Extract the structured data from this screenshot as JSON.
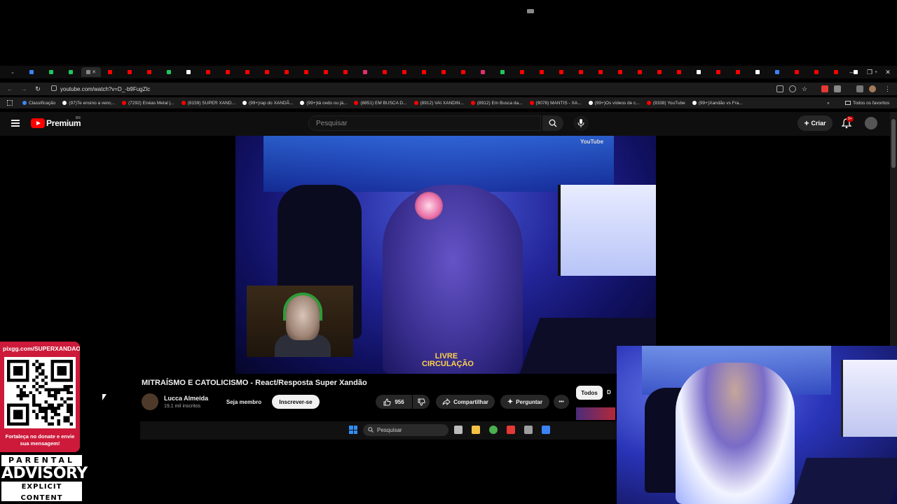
{
  "browser": {
    "tab_colors": [
      "#3b82f6",
      "#22c55e",
      "#22c55e",
      "#888888",
      "#ff0000",
      "#ff0000",
      "#ff0000",
      "#22c55e",
      "#ffffff",
      "#ff0000",
      "#ff0000",
      "#ff0000",
      "#ff0000",
      "#ff0000",
      "#ff0000",
      "#ff0000",
      "#ff0000",
      "#e1306c",
      "#ff0000",
      "#ff0000",
      "#ff0000",
      "#ff0000",
      "#ff0000",
      "#e1306c",
      "#22c55e",
      "#ff0000",
      "#ff0000",
      "#ff0000",
      "#ff0000",
      "#ff0000",
      "#ff0000",
      "#ff0000",
      "#ff0000",
      "#ff0000",
      "#ffffff",
      "#ff0000",
      "#ff0000",
      "#ffffff",
      "#3b82f6",
      "#ff0000",
      "#ff0000",
      "#ff0000",
      "#ffffff"
    ],
    "new_tab": "+",
    "minimize": "–",
    "maximize": "❐",
    "close": "✕",
    "back": "←",
    "forward": "→",
    "reload": "↻",
    "url": "youtube.com/watch?v=D_-b9FugZlc",
    "bookmarks": [
      {
        "label": "Classificação",
        "color": "#4285f4"
      },
      {
        "label": "(97)Te ensino a venc...",
        "color": "#ffffff"
      },
      {
        "label": "(7292) Enéas Metal |...",
        "color": "#ff0000"
      },
      {
        "label": "(8159) SUPER XAND...",
        "color": "#ff0000"
      },
      {
        "label": "(99+)rap do XANDÃ...",
        "color": "#ffffff"
      },
      {
        "label": "(99+)tá cedo ou já...",
        "color": "#ffffff"
      },
      {
        "label": "(8851) EM BUSCA D...",
        "color": "#ff0000"
      },
      {
        "label": "(8912) VAI XANDIN...",
        "color": "#ff0000"
      },
      {
        "label": "(8912) Em Busca da...",
        "color": "#ff0000"
      },
      {
        "label": "(9078) MANTIS - XA...",
        "color": "#ff0000"
      },
      {
        "label": "(99+)Os vídeos de c...",
        "color": "#ffffff"
      },
      {
        "label": "(9338) YouTube",
        "color": "#ff0000"
      },
      {
        "label": "(99+)Xandão vs Fra...",
        "color": "#ffffff"
      }
    ],
    "all_favorites": "Todos os favoritos"
  },
  "youtube": {
    "logo_text": "Premium",
    "country": "BR",
    "search_placeholder": "Pesquisar",
    "create_label": "Criar",
    "notif_badge": "9+",
    "video_watermark": "YouTube",
    "video_overlay_text": "LIVRE CIRCULAÇÃO",
    "title": "MITRAÍSMO E CATOLICISMO - React/Resposta Super Xandão",
    "channel_name": "Lucca Almeida",
    "channel_subs": "19,1 mil inscritos",
    "member_label": "Seja membro",
    "subscribe_label": "Inscrever-se",
    "likes": "956",
    "share_label": "Compartilhar",
    "ask_label": "Perguntar",
    "more_label": "•••",
    "chip_all": "Todos",
    "chip_next": "D"
  },
  "taskbar": {
    "search_placeholder": "Pesquisar",
    "app_colors": [
      "#bbbbbb",
      "#f3c145",
      "#4caf50",
      "#e53935",
      "#9e9e9e",
      "#3b82f6"
    ]
  },
  "overlay": {
    "qr_url": "pixgg.com/SUPERXANDAO",
    "qr_caption": "Fortaleça no donate e envie sua mensagem!",
    "advisory_top": "PARENTAL",
    "advisory_mid": "ADVISORY",
    "advisory_bot": "EXPLICIT CONTENT"
  }
}
